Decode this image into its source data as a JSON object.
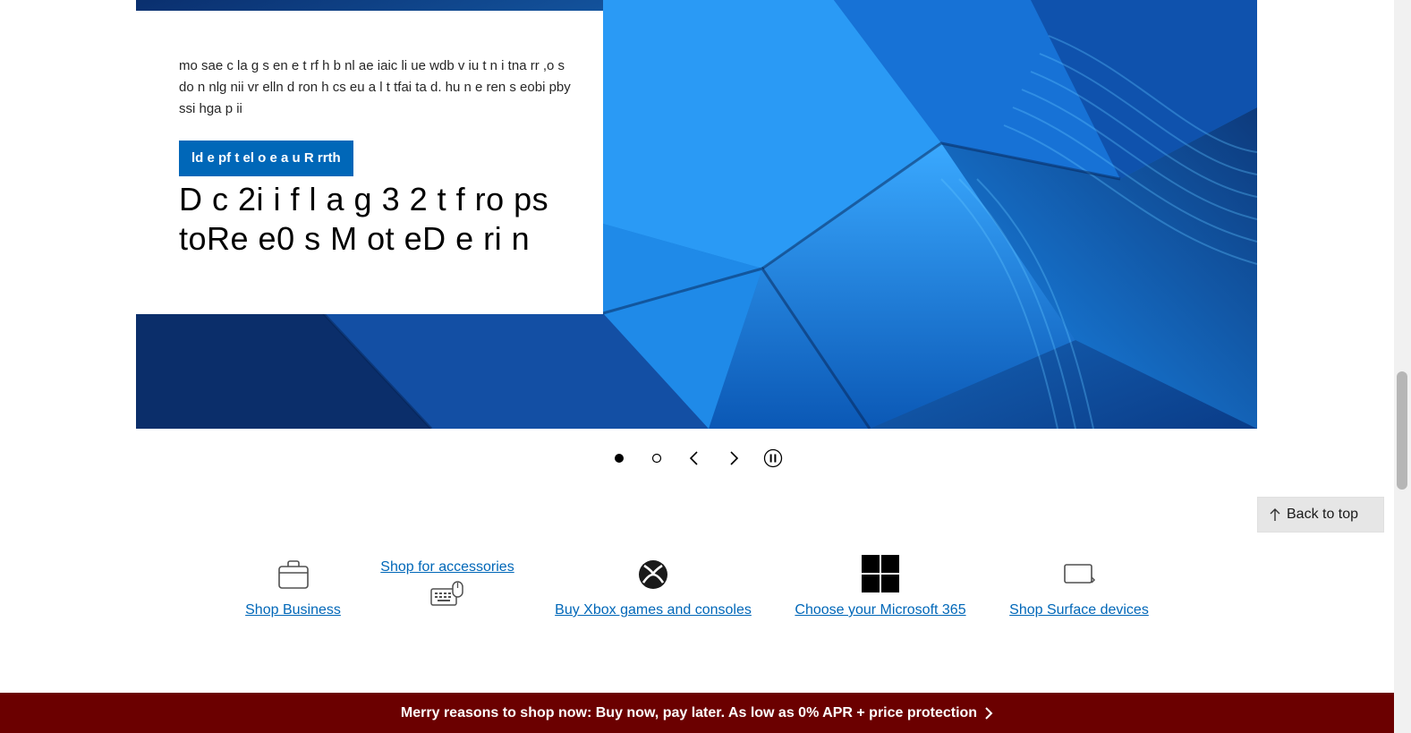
{
  "hero": {
    "description": "mo sae c la g s en e t rf h b nl ae iaic li ue wdb v iu t n i tna rr ,o s do n nlg nii vr elln d ron h cs eu a l t tfai ta d. hu n e ren s eobi pby ssi hga p ii",
    "cta_label": "ld e pf t el o e a u R rrth",
    "title": "D c 2i i f l a g 3 2 t f ro ps toRe e0 s M ot eD e ri n",
    "accent_color": "#0067b8",
    "background_icon": "blue-abstract-wave-image"
  },
  "carousel": {
    "slide_count": 2,
    "active_slide": 1,
    "controls": [
      "slide-1-dot",
      "slide-2-dot",
      "previous-arrow",
      "next-arrow",
      "pause-icon"
    ]
  },
  "back_to_top": {
    "label": "Back to top",
    "icon": "arrow-up-icon"
  },
  "quick_links": [
    {
      "label": "Shop Business",
      "icon": "briefcase-icon"
    },
    {
      "label": "Shop for accessories",
      "icon": "keyboard-mouse-icon"
    },
    {
      "label": "Buy Xbox games and consoles",
      "icon": "xbox-icon"
    },
    {
      "label": "Choose your Microsoft 365",
      "icon": "windows-logo-icon"
    },
    {
      "label": "Shop Surface devices",
      "icon": "surface-tablet-icon"
    }
  ],
  "promo": {
    "text": "Merry reasons to shop now: Buy now, pay later. As low as 0% APR + price protection",
    "background_color": "#6b0000",
    "icon": "chevron-right-icon"
  }
}
